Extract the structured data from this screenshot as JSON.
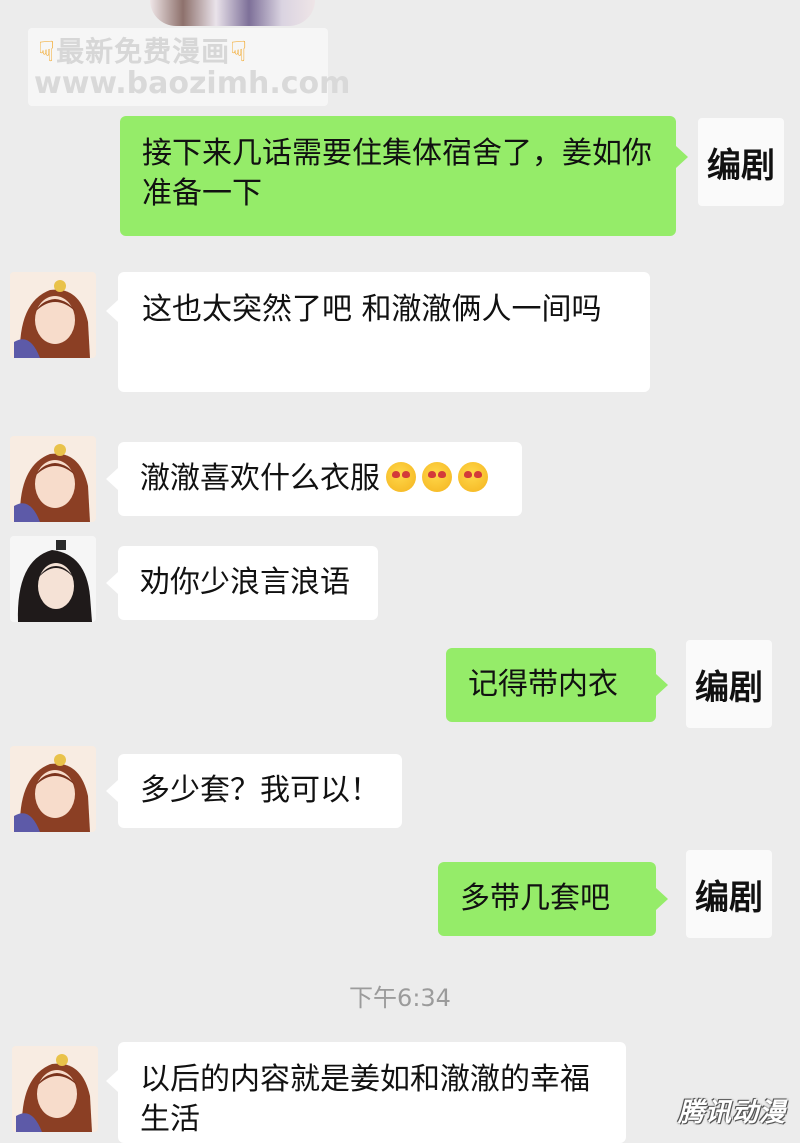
{
  "watermark": {
    "line1": "最新免费漫画",
    "line2": "www.baozimh.com"
  },
  "messages": [
    {
      "side": "right",
      "text": "接下来几话需要住集体宿舍了，姜如你准备一下",
      "name": "编剧"
    },
    {
      "side": "left",
      "text": "这也太突然了吧 和澈澈俩人一间吗",
      "avatar": "female-character-avatar"
    },
    {
      "side": "left",
      "text": "澈澈喜欢什么衣服",
      "emoji": [
        "heart-eyes-emoji",
        "heart-eyes-emoji",
        "heart-eyes-emoji"
      ],
      "avatar": "female-character-avatar"
    },
    {
      "side": "left",
      "text": "劝你少浪言浪语",
      "avatar": "male-character-avatar"
    },
    {
      "side": "right",
      "text": "记得带内衣",
      "name": "编剧"
    },
    {
      "side": "left",
      "text": "多少套？我可以！",
      "avatar": "female-character-avatar"
    },
    {
      "side": "right",
      "text": "多带几套吧",
      "name": "编剧"
    },
    {
      "side": "left",
      "text": "以后的内容就是姜如和澈澈的幸福生活",
      "avatar": "female-character-avatar"
    }
  ],
  "timestamp": "下午6:34",
  "corner_logo": "腾讯动漫",
  "colors": {
    "background": "#ececec",
    "bubble_green": "#95ec69",
    "bubble_white": "#ffffff",
    "timestamp": "#9b9b9b"
  }
}
